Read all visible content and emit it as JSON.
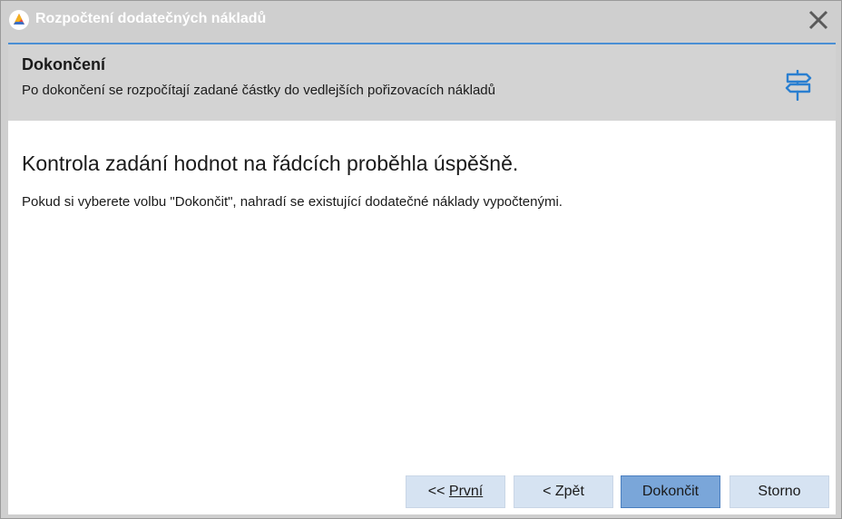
{
  "window": {
    "title": "Rozpočtení dodatečných nákladů"
  },
  "header": {
    "title": "Dokončení",
    "subtitle": "Po dokončení se rozpočítají zadané částky do vedlejších pořizovacích nákladů"
  },
  "main": {
    "heading": "Kontrola zadání hodnot na řádcích proběhla úspěšně.",
    "text": "Pokud si vyberete volbu \"Dokončit\", nahradí se existující dodatečné náklady vypočtenými."
  },
  "buttons": {
    "first_prefix": "<< ",
    "first_label": "První",
    "back_label": "< Zpět",
    "finish_label": "Dokončit",
    "cancel_label": "Storno"
  },
  "icons": {
    "app": "app-logo-icon",
    "close": "close-icon",
    "signpost": "signpost-icon"
  },
  "colors": {
    "accent": "#4a8fd4",
    "primary_button": "#7aa6d9",
    "button": "#d6e3f2",
    "header_band": "#d3d3d3"
  }
}
